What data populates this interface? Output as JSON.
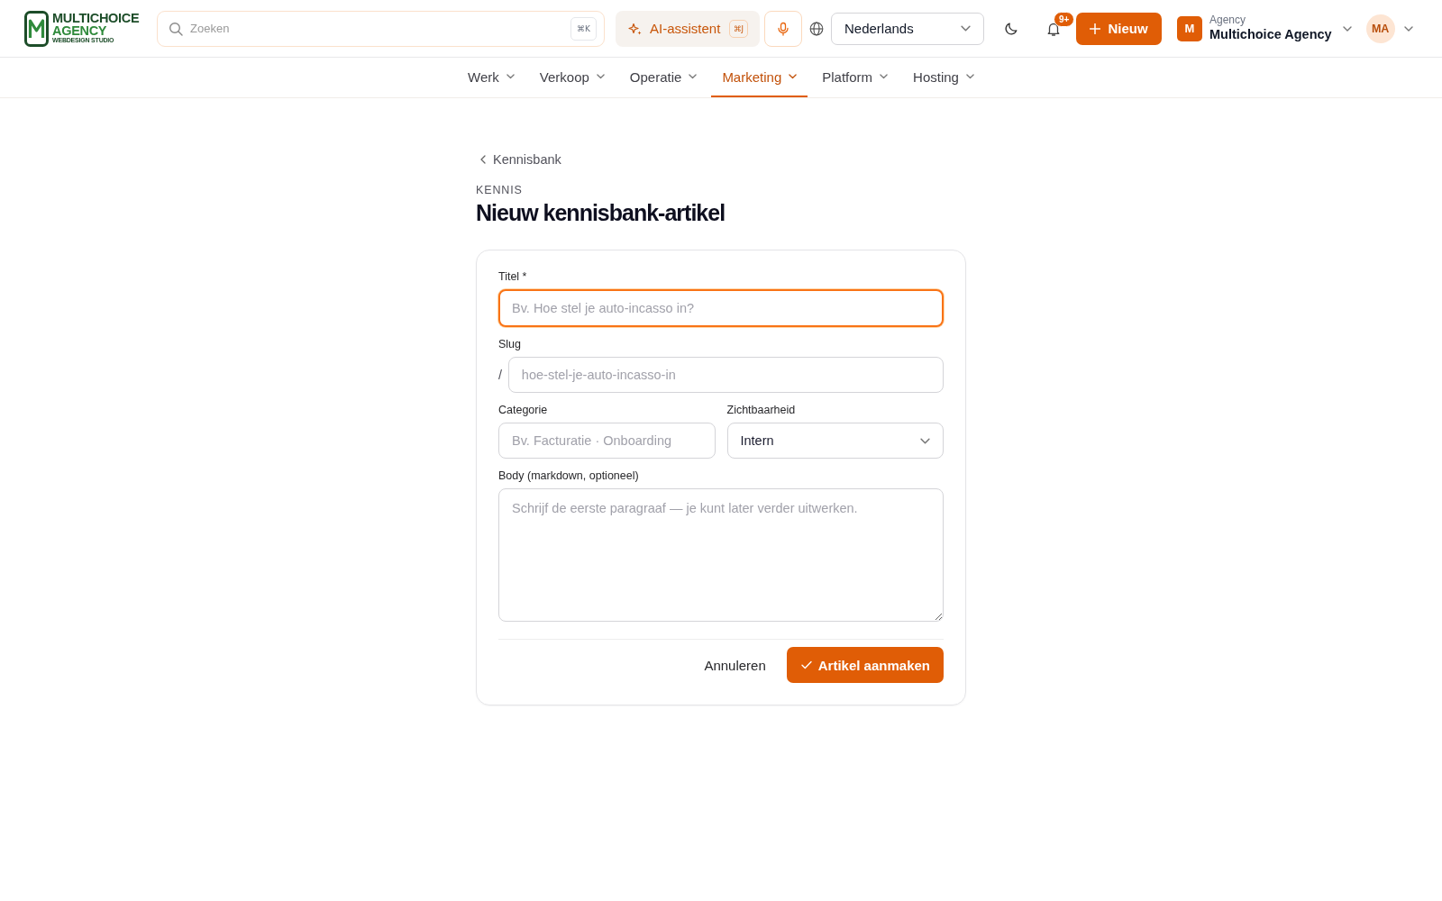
{
  "header": {
    "logo": {
      "name": "MULTICHOICE",
      "subname": "AGENCY",
      "tagline": "WEBDESIGN STUDIO"
    },
    "search": {
      "placeholder": "Zoeken",
      "shortcut": "⌘K"
    },
    "ai_button": {
      "label": "AI-assistent",
      "shortcut": "⌘J"
    },
    "language_select": {
      "value": "Nederlands"
    },
    "notifications": {
      "badge": "9+"
    },
    "new_button": {
      "label": "Nieuw"
    },
    "account": {
      "initial": "M",
      "type_label": "Agency",
      "name": "Multichoice Agency"
    },
    "avatar": {
      "initials": "MA"
    }
  },
  "nav": [
    {
      "label": "Werk",
      "selected": false
    },
    {
      "label": "Verkoop",
      "selected": false
    },
    {
      "label": "Operatie",
      "selected": false
    },
    {
      "label": "Marketing",
      "selected": true
    },
    {
      "label": "Platform",
      "selected": false
    },
    {
      "label": "Hosting",
      "selected": false
    }
  ],
  "breadcrumb": {
    "label": "Kennisbank"
  },
  "eyebrow": "KENNIS",
  "title": "Nieuw kennisbank-artikel",
  "form": {
    "rows": [
      {
        "fields": [
          {
            "kind": "text",
            "label": "Titel *",
            "placeholder": "Bv. Hoe stel je auto-incasso in?",
            "focused": true
          }
        ]
      },
      {
        "fields": [
          {
            "kind": "slug",
            "label": "Slug",
            "prefix": "/",
            "placeholder": "hoe-stel-je-auto-incasso-in",
            "focused": false
          }
        ]
      },
      {
        "fields": [
          {
            "kind": "text",
            "label": "Categorie",
            "placeholder": "Bv. Facturatie · Onboarding",
            "focused": false
          },
          {
            "kind": "select",
            "label": "Zichtbaarheid",
            "value": "Intern",
            "focused": false
          }
        ]
      },
      {
        "fields": [
          {
            "kind": "textarea",
            "label": "Body (markdown, optioneel)",
            "placeholder": "Schrijf de eerste paragraaf — je kunt later verder uitwerken.",
            "focused": false
          }
        ]
      }
    ],
    "cancel_button": {
      "label": "Annuleren"
    },
    "submit_button": {
      "label": "Artikel aanmaken"
    }
  }
}
